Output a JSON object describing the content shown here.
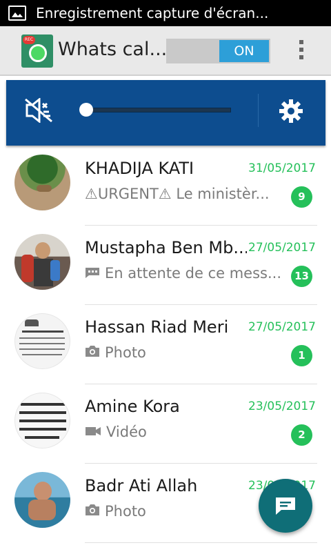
{
  "status_bar": {
    "notification_text": "Enregistrement capture d'écran..."
  },
  "action_bar": {
    "title": "Whats cal...",
    "app_icon_badge": "REC",
    "toggle_label": "ON"
  },
  "chats": [
    {
      "name": "KHADIJA KATI",
      "date": "31/05/2017",
      "preview": "⚠URGENT⚠ Le ministèr...",
      "preview_icon": "",
      "unread": "9"
    },
    {
      "name": "Mustapha Ben Mb...",
      "date": "27/05/2017",
      "preview": "En attente de ce mess...",
      "preview_icon": "message-pending-icon",
      "unread": "13"
    },
    {
      "name": "Hassan Riad Meri",
      "date": "27/05/2017",
      "preview": "Photo",
      "preview_icon": "camera-icon",
      "unread": "1"
    },
    {
      "name": "Amine Kora",
      "date": "23/05/2017",
      "preview": "Vidéo",
      "preview_icon": "video-icon",
      "unread": "2"
    },
    {
      "name": "Badr Ati Allah",
      "date": "23/05/2017",
      "preview": "Photo",
      "preview_icon": "camera-icon",
      "unread": ""
    }
  ],
  "colors": {
    "accent_green": "#25c05a",
    "player_blue": "#0d4d8f",
    "toggle_blue": "#2d9fd8",
    "fab": "#0f6e77"
  }
}
